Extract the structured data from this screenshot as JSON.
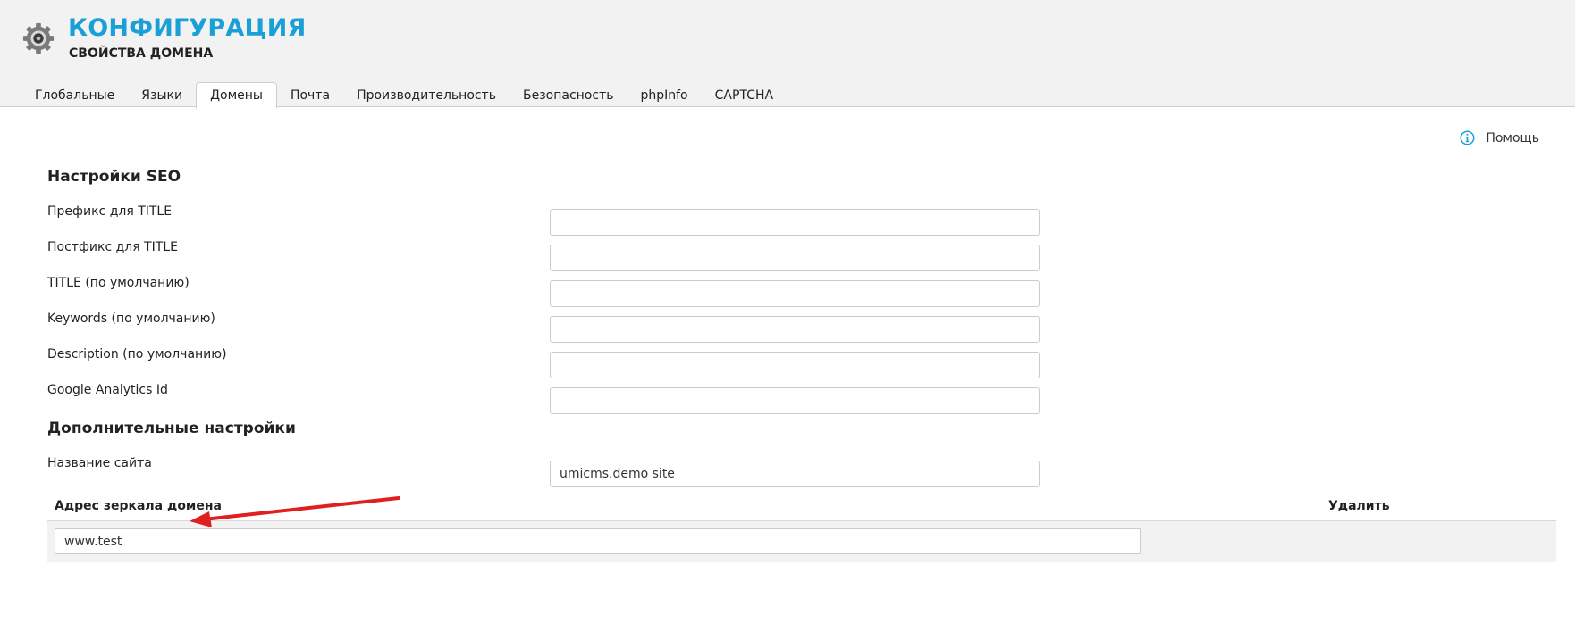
{
  "header": {
    "title": "КОНФИГУРАЦИЯ",
    "subtitle": "СВОЙСТВА ДОМЕНА",
    "logo_icon": "gear-icon",
    "accent_color": "#1a9fd7"
  },
  "tabs": [
    {
      "label": "Глобальные",
      "active": false
    },
    {
      "label": "Языки",
      "active": false
    },
    {
      "label": "Домены",
      "active": true
    },
    {
      "label": "Почта",
      "active": false
    },
    {
      "label": "Производительность",
      "active": false
    },
    {
      "label": "Безопасность",
      "active": false
    },
    {
      "label": "phpInfo",
      "active": false
    },
    {
      "label": "CAPTCHA",
      "active": false
    }
  ],
  "help": {
    "label": "Помощь",
    "icon": "info-icon"
  },
  "seo": {
    "title": "Настройки SEO",
    "fields": [
      {
        "label": "Префикс для TITLE",
        "value": ""
      },
      {
        "label": "Постфикс для TITLE",
        "value": ""
      },
      {
        "label": "TITLE (по умолчанию)",
        "value": ""
      },
      {
        "label": "Keywords (по умолчанию)",
        "value": ""
      },
      {
        "label": "Description (по умолчанию)",
        "value": ""
      },
      {
        "label": "Google Analytics Id",
        "value": ""
      }
    ]
  },
  "extra": {
    "title": "Дополнительные настройки",
    "fields": [
      {
        "label": "Название сайта",
        "value": "umicms.demo site"
      }
    ]
  },
  "mirrors": {
    "col_address": "Адрес зеркала домена",
    "col_delete": "Удалить",
    "rows": [
      {
        "address": "www.test"
      }
    ]
  },
  "annotation": {
    "arrow_color": "#e02020"
  }
}
